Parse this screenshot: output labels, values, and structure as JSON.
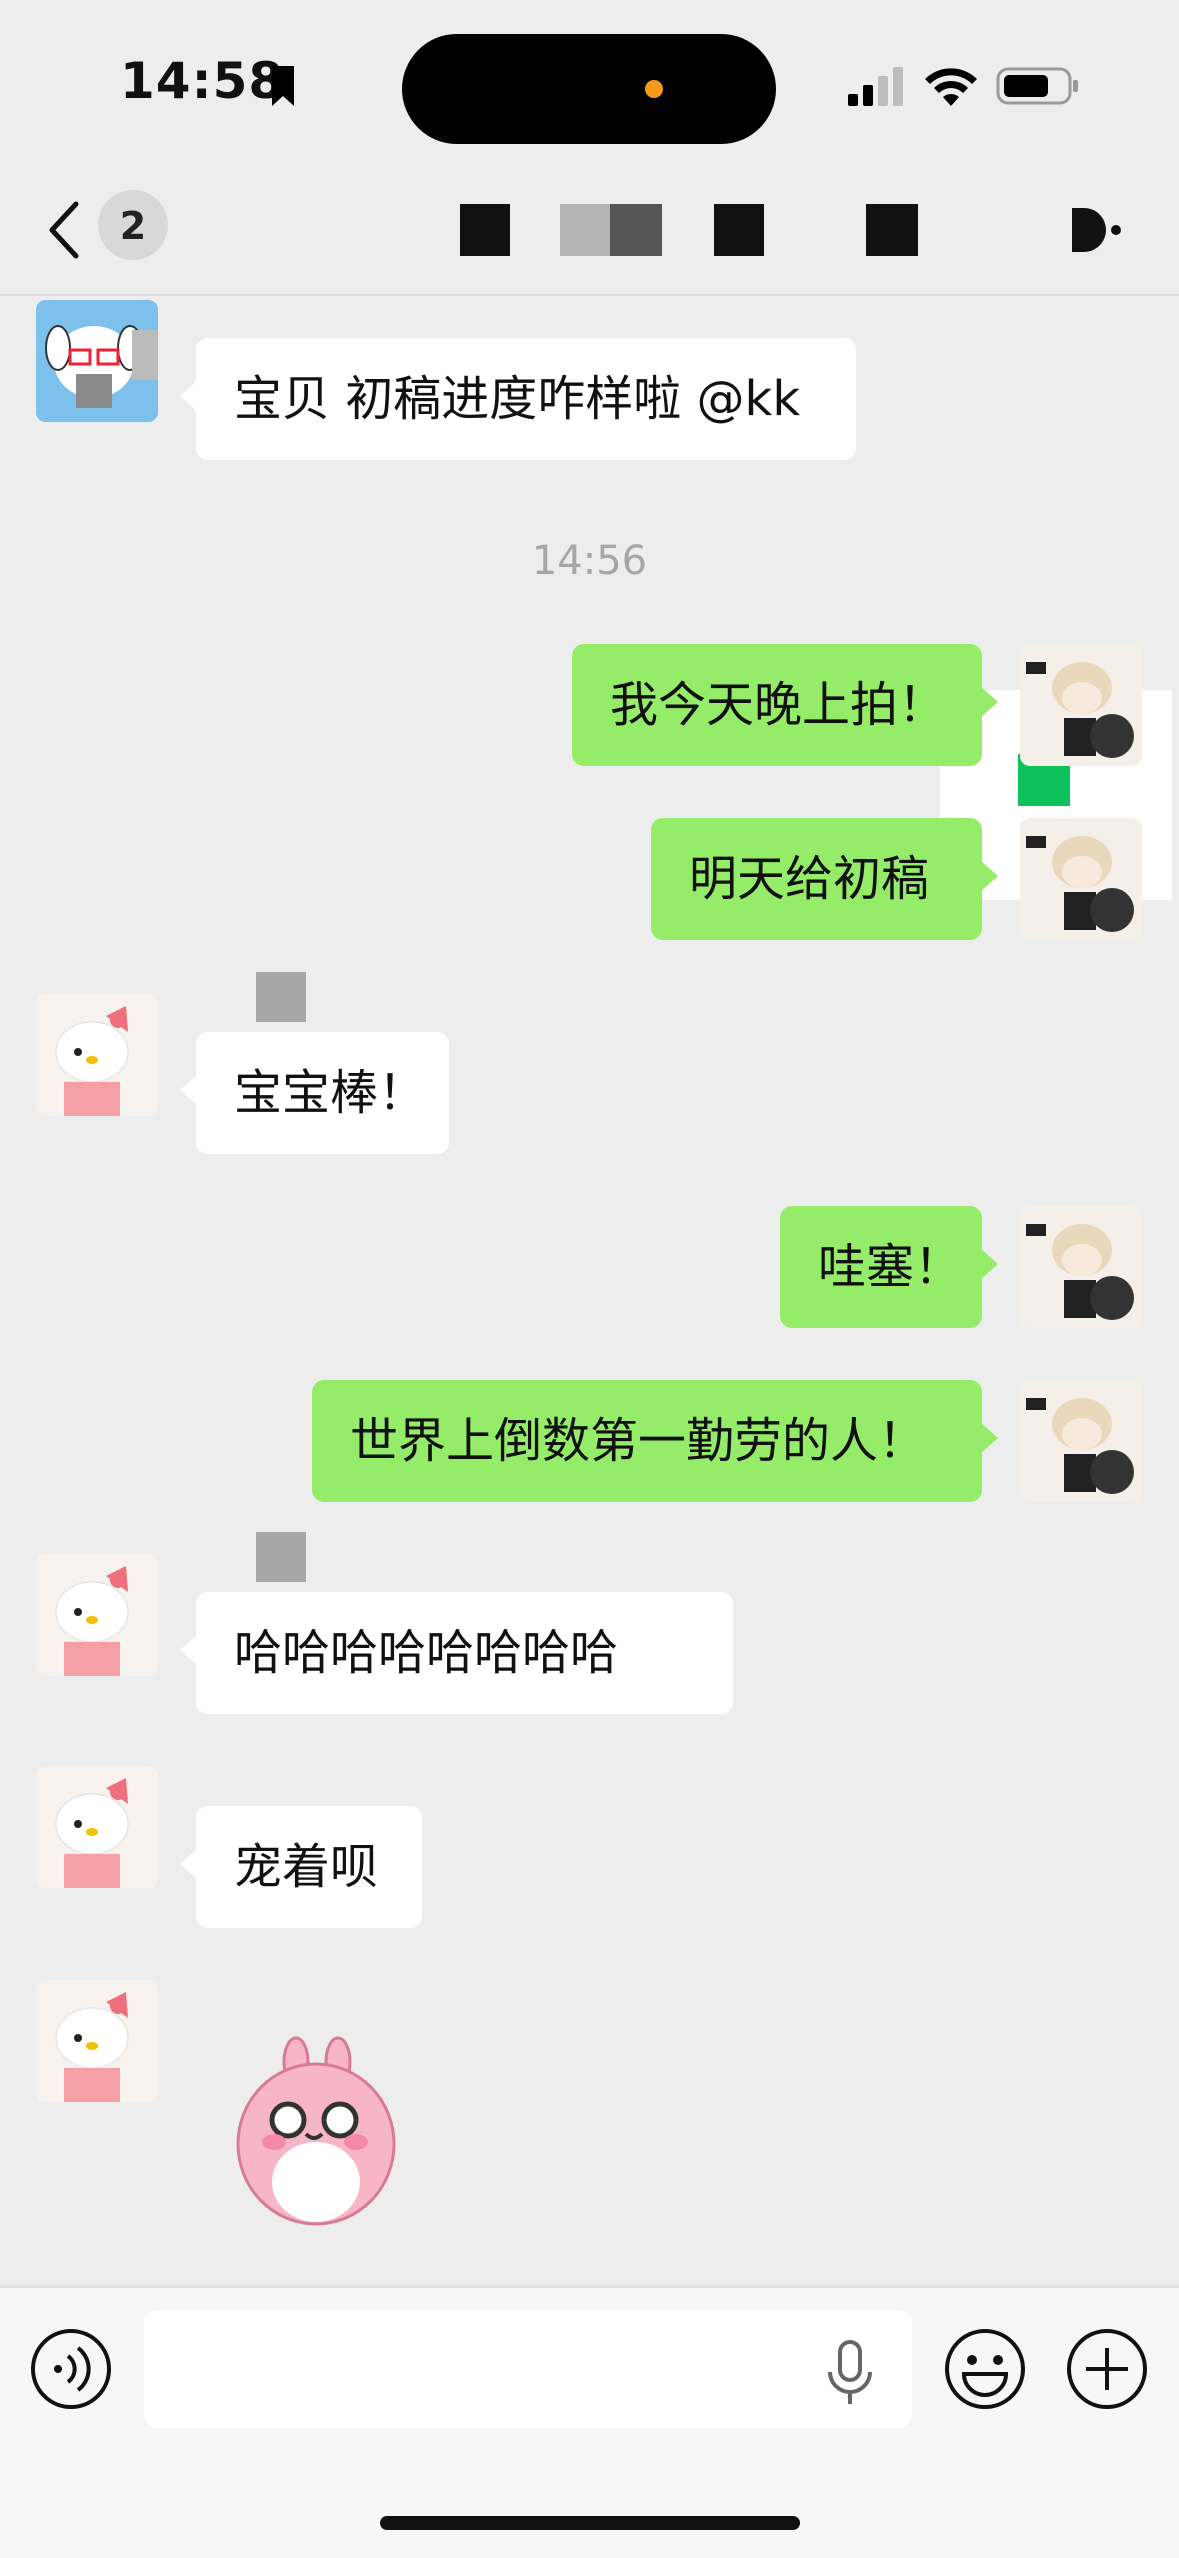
{
  "status_bar": {
    "time": "14:58",
    "icons": [
      "bookmark-icon",
      "cellular-signal-icon",
      "wifi-icon",
      "battery-icon"
    ],
    "island_indicator_color": "#f59a1b"
  },
  "nav": {
    "back_icon": "chevron-left-icon",
    "unread_count": "2",
    "more_icon": "more-dots-icon"
  },
  "messages": [
    {
      "side": "in",
      "text": "宝贝 初稿进度咋样啦 @kk",
      "avatar": "puppy-avatar"
    },
    {
      "type": "time",
      "text": "14:56"
    },
    {
      "side": "out",
      "text": "我今天晚上拍！",
      "avatar": "doll-avatar"
    },
    {
      "side": "out",
      "text": "明天给初稿",
      "avatar": "doll-avatar"
    },
    {
      "side": "in",
      "text": "宝宝棒！",
      "avatar": "kitty-avatar"
    },
    {
      "side": "out",
      "text": "哇塞！",
      "avatar": "doll-avatar"
    },
    {
      "side": "out",
      "text": "世界上倒数第一勤劳的人！",
      "avatar": "doll-avatar"
    },
    {
      "side": "in",
      "text": "哈哈哈哈哈哈哈哈",
      "avatar": "kitty-avatar"
    },
    {
      "side": "in",
      "text": "宠着呗",
      "avatar": "kitty-avatar"
    },
    {
      "side": "in",
      "type": "sticker",
      "sticker": "pink-bunny-sticker",
      "avatar": "kitty-avatar"
    }
  ],
  "input_bar": {
    "voice_icon": "voice-icon",
    "placeholder": "",
    "mic_icon": "microphone-icon",
    "emoji_icon": "emoji-icon",
    "plus_icon": "plus-icon"
  },
  "colors": {
    "background": "#ededed",
    "outgoing_bubble": "#95ec69",
    "incoming_bubble": "#ffffff",
    "timestamp": "#a6a6a6"
  }
}
